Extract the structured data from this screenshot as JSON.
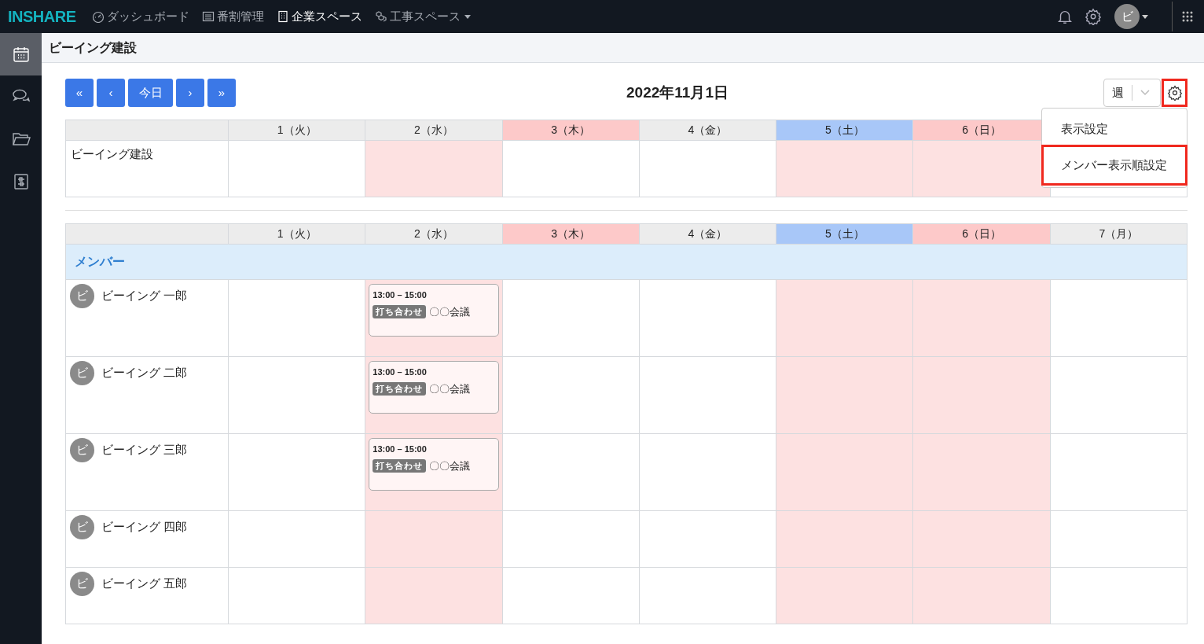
{
  "topbar": {
    "logo": "INSHARE",
    "nav": [
      {
        "label": "ダッシュボード",
        "kind": "gauge",
        "selected": false,
        "caret": false
      },
      {
        "label": "番割管理",
        "kind": "list",
        "selected": false,
        "caret": false
      },
      {
        "label": "企業スペース",
        "kind": "building",
        "selected": true,
        "caret": false
      },
      {
        "label": "工事スペース",
        "kind": "cubes",
        "selected": false,
        "caret": true
      }
    ],
    "avatar": "ビ"
  },
  "sidebar": [
    {
      "kind": "calendar",
      "selected": true
    },
    {
      "kind": "chat",
      "selected": false
    },
    {
      "kind": "folder",
      "selected": false
    },
    {
      "kind": "sliders",
      "selected": false
    }
  ],
  "page_title": "ビーイング建設",
  "toolbar": {
    "buttons": [
      "«",
      "‹",
      "今日",
      "›",
      "»"
    ],
    "date": "2022年11月1日",
    "view": "週",
    "settings_highlighted": true
  },
  "settings_menu": {
    "items": [
      {
        "label": "表示設定",
        "highlighted": false
      },
      {
        "label": "メンバー表示順設定",
        "highlighted": true
      }
    ]
  },
  "company_table": {
    "days": [
      {
        "label": "1（火）",
        "kind": "weekday",
        "shaded": false
      },
      {
        "label": "2（水）",
        "kind": "weekday",
        "shaded": true
      },
      {
        "label": "3（木）",
        "kind": "holiday",
        "shaded": false
      },
      {
        "label": "4（金）",
        "kind": "weekday",
        "shaded": false
      },
      {
        "label": "5（土）",
        "kind": "saturday",
        "shaded": true
      },
      {
        "label": "6（日）",
        "kind": "holiday",
        "shaded": true
      }
    ],
    "name": "ビーイング建設"
  },
  "member_table": {
    "days": [
      {
        "label": "1（火）",
        "kind": "weekday",
        "shaded": false
      },
      {
        "label": "2（水）",
        "kind": "weekday",
        "shaded": true
      },
      {
        "label": "3（木）",
        "kind": "holiday",
        "shaded": false
      },
      {
        "label": "4（金）",
        "kind": "weekday",
        "shaded": false
      },
      {
        "label": "5（土）",
        "kind": "saturday",
        "shaded": true
      },
      {
        "label": "6（日）",
        "kind": "holiday",
        "shaded": true
      },
      {
        "label": "7（月）",
        "kind": "weekday",
        "shaded": false
      }
    ],
    "group": "メンバー",
    "members": [
      {
        "avatar": "ビ",
        "name": "ビーイング 一郎",
        "cells": [
          {},
          {
            "events": [
              {
                "time": "13:00 – 15:00",
                "tag": "打ち合わせ",
                "title": "〇〇会議"
              }
            ]
          },
          {},
          {},
          {},
          {},
          {}
        ]
      },
      {
        "avatar": "ビ",
        "name": "ビーイング 二郎",
        "cells": [
          {},
          {
            "events": [
              {
                "time": "13:00 – 15:00",
                "tag": "打ち合わせ",
                "title": "〇〇会議"
              }
            ]
          },
          {},
          {},
          {},
          {},
          {}
        ]
      },
      {
        "avatar": "ビ",
        "name": "ビーイング 三郎",
        "cells": [
          {},
          {
            "events": [
              {
                "time": "13:00 – 15:00",
                "tag": "打ち合わせ",
                "title": "〇〇会議"
              }
            ]
          },
          {},
          {},
          {},
          {},
          {}
        ]
      },
      {
        "avatar": "ビ",
        "name": "ビーイング 四郎",
        "cells": [
          {},
          {},
          {},
          {},
          {},
          {},
          {}
        ]
      },
      {
        "avatar": "ビ",
        "name": "ビーイング 五郎",
        "cells": [
          {},
          {},
          {},
          {},
          {},
          {},
          {}
        ]
      }
    ]
  }
}
